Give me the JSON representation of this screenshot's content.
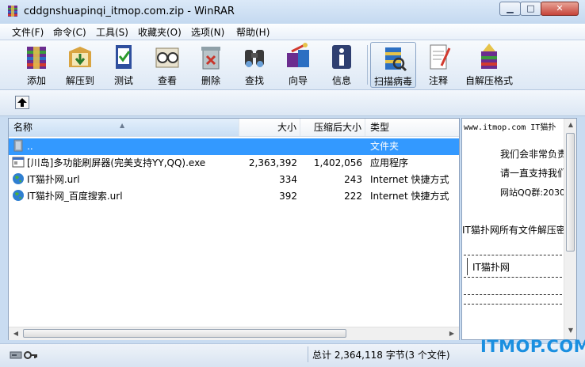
{
  "window": {
    "title": "cddgnshuapinqi_itmop.com.zip - WinRAR",
    "controls": {
      "minimize": "▁",
      "maximize": "□",
      "close": "✕"
    }
  },
  "menu": [
    "文件(F)",
    "命令(C)",
    "工具(S)",
    "收藏夹(O)",
    "选项(N)",
    "帮助(H)"
  ],
  "toolbar": [
    {
      "label": "添加",
      "icon": "add-archive-icon"
    },
    {
      "label": "解压到",
      "icon": "extract-to-icon"
    },
    {
      "label": "测试",
      "icon": "test-icon"
    },
    {
      "label": "查看",
      "icon": "view-icon"
    },
    {
      "label": "删除",
      "icon": "delete-icon"
    },
    {
      "label": "查找",
      "icon": "find-icon"
    },
    {
      "label": "向导",
      "icon": "wizard-icon"
    },
    {
      "label": "信息",
      "icon": "info-icon"
    },
    {
      "label": "扫描病毒",
      "icon": "virus-scan-icon"
    },
    {
      "label": "注释",
      "icon": "comment-icon"
    },
    {
      "label": "自解压格式",
      "icon": "sfx-icon"
    }
  ],
  "columns": {
    "name": "名称",
    "size": "大小",
    "packed": "压缩后大小",
    "type": "类型"
  },
  "files": [
    {
      "name": "..",
      "size": "",
      "packed": "",
      "type": "文件夹",
      "icon": "folder-up-icon",
      "selected": true
    },
    {
      "name": "[川岛]多功能刷屏器(完美支持YY,QQ).exe",
      "size": "2,363,392",
      "packed": "1,402,056",
      "type": "应用程序",
      "icon": "exe-file-icon",
      "selected": false
    },
    {
      "name": "IT猫扑网.url",
      "size": "334",
      "packed": "243",
      "type": "Internet 快捷方式",
      "icon": "url-globe-icon",
      "selected": false
    },
    {
      "name": "IT猫扑网_百度搜索.url",
      "size": "392",
      "packed": "222",
      "type": "Internet 快捷方式",
      "icon": "url-globe-icon",
      "selected": false
    }
  ],
  "preview": {
    "header": "www.itmop.com  IT猫扑",
    "line1": "我们会非常负责",
    "line2": "请一直支持我们",
    "line3": "网站QQ群:2030",
    "line4": "IT猫扑网所有文件解压密",
    "box_label": "IT猫扑网"
  },
  "status": {
    "summary": "总计 2,364,118 字节(3 个文件)"
  },
  "watermark": "ITMOP.COM",
  "colors": {
    "selection": "#3399ff",
    "watermark": "#1a8fe0"
  }
}
